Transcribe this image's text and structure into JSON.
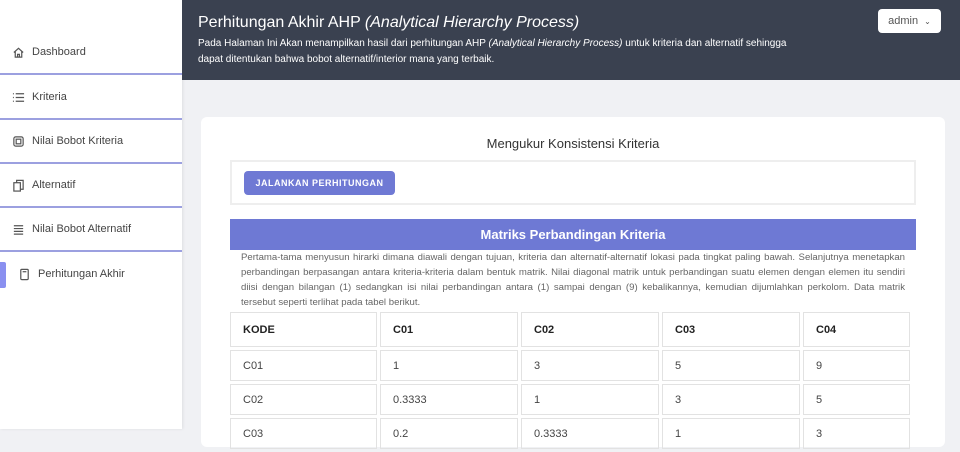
{
  "sidebar": {
    "items": [
      {
        "label": "Dashboard",
        "icon": "home-icon"
      },
      {
        "label": "Kriteria",
        "icon": "list-icon"
      },
      {
        "label": "Nilai Bobot Kriteria",
        "icon": "chip-icon"
      },
      {
        "label": "Alternatif",
        "icon": "copy-icon"
      },
      {
        "label": "Nilai Bobot Alternatif",
        "icon": "stack-icon"
      },
      {
        "label": "Perhitungan Akhir",
        "icon": "document-icon",
        "active": true
      }
    ]
  },
  "header": {
    "title": "Perhitungan Akhir AHP ",
    "title_italic": "(Analytical Hierarchy Process)",
    "desc_a": "Pada Halaman Ini Akan menampilkan hasil dari perhitungan AHP ",
    "desc_italic": "(Analytical Hierarchy Process)",
    "desc_b": " untuk kriteria dan alternatif sehingga dapat ditentukan bahwa bobot alternatif/interior mana yang terbaik.",
    "user": "admin"
  },
  "card": {
    "title": "Mengukur Konsistensi Kriteria",
    "run_button": "JALANKAN PERHITUNGAN",
    "section_title": "Matriks Perbandingan Kriteria",
    "description": "Pertama-tama menyusun hirarki dimana diawali dengan tujuan, kriteria dan alternatif-alternatif lokasi pada tingkat paling bawah. Selanjutnya menetapkan perbandingan berpasangan antara kriteria-kriteria dalam bentuk matrik. Nilai diagonal matrik untuk perbandingan suatu elemen dengan elemen itu sendiri diisi dengan bilangan (1) sedangkan isi nilai perbandingan antara (1) sampai dengan (9) kebalikannya, kemudian dijumlahkan perkolom. Data matrik tersebut seperti terlihat pada tabel berikut."
  },
  "table": {
    "headers": [
      "KODE",
      "C01",
      "C02",
      "C03",
      "C04"
    ],
    "rows": [
      [
        "C01",
        "1",
        "3",
        "5",
        "9"
      ],
      [
        "C02",
        "0.3333",
        "1",
        "3",
        "5"
      ],
      [
        "C03",
        "0.2",
        "0.3333",
        "1",
        "3"
      ]
    ]
  },
  "colors": {
    "header_bg": "#3a4150",
    "accent": "#6e79d4"
  }
}
